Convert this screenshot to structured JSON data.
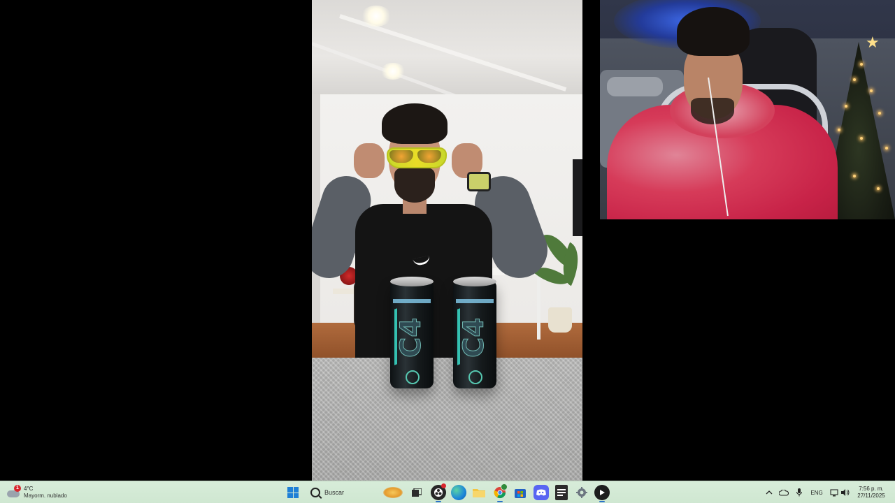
{
  "taskbar": {
    "weather": {
      "badge": "1",
      "temperature": "4°C",
      "description": "Mayorm. nublado"
    },
    "search": {
      "label": "Buscar"
    },
    "tray": {
      "language": "ENG"
    },
    "clock": {
      "time": "7:56 p. m.",
      "date": "27/11/2025"
    },
    "apps": [
      {
        "name": "task-view",
        "icon": "task-view-icon"
      },
      {
        "name": "obs",
        "icon": "obs-icon"
      },
      {
        "name": "edge",
        "icon": "edge-icon"
      },
      {
        "name": "file-explorer",
        "icon": "folder-icon"
      },
      {
        "name": "chrome",
        "icon": "chrome-icon"
      },
      {
        "name": "microsoft-store",
        "icon": "store-icon"
      },
      {
        "name": "discord",
        "icon": "discord-icon"
      },
      {
        "name": "epic-games",
        "icon": "epic-games-icon"
      },
      {
        "name": "settings",
        "icon": "gear-icon"
      },
      {
        "name": "media-player",
        "icon": "play-icon"
      }
    ],
    "colors": {
      "background": "#d3e9d5",
      "accent": "#2b73c9"
    }
  },
  "video": {
    "cans": [
      {
        "logo": "C4"
      },
      {
        "logo": "C4"
      }
    ]
  }
}
